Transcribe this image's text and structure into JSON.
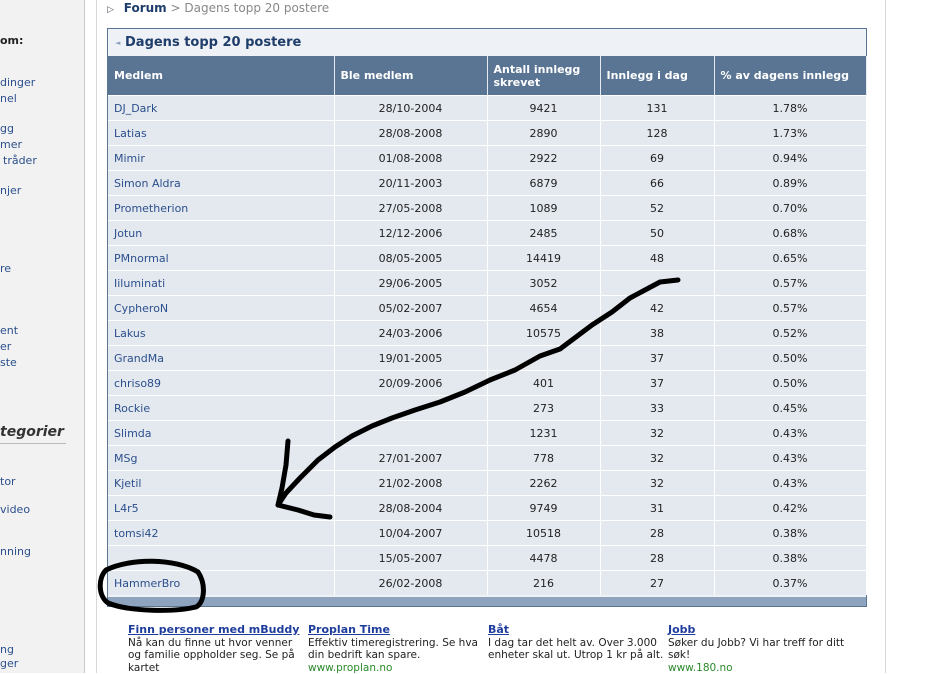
{
  "sidebar": {
    "header": "om:",
    "items": [
      "dinger",
      "nel",
      "gg",
      "mer",
      "tråder",
      "njer",
      "re",
      "ent",
      "er",
      "ste"
    ],
    "category_title": "tegorier",
    "category_items": [
      "tor",
      "video",
      "nning",
      "ng",
      "ger"
    ]
  },
  "breadcrumb": {
    "root": "Forum",
    "separator": ">",
    "current": "Dagens topp 20 postere"
  },
  "panel": {
    "title": "Dagens topp 20 postere",
    "columns": [
      "Medlem",
      "Ble medlem",
      "Antall innlegg skrevet",
      "Innlegg i dag",
      "% av dagens innlegg"
    ],
    "rows": [
      {
        "name": "DJ_Dark",
        "joined": "28/10-2004",
        "posts": "9421",
        "today": "131",
        "pct": "1.78%"
      },
      {
        "name": "Latias",
        "joined": "28/08-2008",
        "posts": "2890",
        "today": "128",
        "pct": "1.73%"
      },
      {
        "name": "Mimir",
        "joined": "01/08-2008",
        "posts": "2922",
        "today": "69",
        "pct": "0.94%"
      },
      {
        "name": "Simon Aldra",
        "joined": "20/11-2003",
        "posts": "6879",
        "today": "66",
        "pct": "0.89%"
      },
      {
        "name": "Prometherion",
        "joined": "27/05-2008",
        "posts": "1089",
        "today": "52",
        "pct": "0.70%"
      },
      {
        "name": "Jotun",
        "joined": "12/12-2006",
        "posts": "2485",
        "today": "50",
        "pct": "0.68%"
      },
      {
        "name": "PMnormal",
        "joined": "08/05-2005",
        "posts": "14419",
        "today": "48",
        "pct": "0.65%"
      },
      {
        "name": "Iiluminati",
        "joined": "29/06-2005",
        "posts": "3052",
        "today": "",
        "pct": "0.57%"
      },
      {
        "name": "CypheroN",
        "joined": "05/02-2007",
        "posts": "4654",
        "today": "42",
        "pct": "0.57%"
      },
      {
        "name": "Lakus",
        "joined": "24/03-2006",
        "posts": "10575",
        "today": "38",
        "pct": "0.52%"
      },
      {
        "name": "GrandMa",
        "joined": "19/01-2005",
        "posts": "",
        "today": "37",
        "pct": "0.50%"
      },
      {
        "name": "chriso89",
        "joined": "20/09-2006",
        "posts": "401",
        "today": "37",
        "pct": "0.50%"
      },
      {
        "name": "Rockie",
        "joined": "",
        "posts": "273",
        "today": "33",
        "pct": "0.45%"
      },
      {
        "name": "Slimda",
        "joined": "",
        "posts": "1231",
        "today": "32",
        "pct": "0.43%"
      },
      {
        "name": "MSg",
        "joined": "27/01-2007",
        "posts": "778",
        "today": "32",
        "pct": "0.43%"
      },
      {
        "name": "Kjetil",
        "joined": "21/02-2008",
        "posts": "2262",
        "today": "32",
        "pct": "0.43%"
      },
      {
        "name": "L4r5",
        "joined": "28/08-2004",
        "posts": "9749",
        "today": "31",
        "pct": "0.42%"
      },
      {
        "name": "tomsi42",
        "joined": "10/04-2007",
        "posts": "10518",
        "today": "28",
        "pct": "0.38%"
      },
      {
        "name": "",
        "joined": "15/05-2007",
        "posts": "4478",
        "today": "28",
        "pct": "0.38%"
      },
      {
        "name": "HammerBro",
        "joined": "26/02-2008",
        "posts": "216",
        "today": "27",
        "pct": "0.37%"
      }
    ]
  },
  "ads": [
    {
      "title": "Finn personer med mBuddy",
      "text": "Nå kan du finne ut hvor venner og familie oppholder seg. Se på kartet",
      "url": ""
    },
    {
      "title": "Proplan Time",
      "text": "Effektiv timeregistrering. Se hva din bedrift kan spare.",
      "url": "www.proplan.no"
    },
    {
      "title": "Båt",
      "text": "I dag tar det helt av. Over 3.000 enheter skal ut. Utrop 1 kr på alt.",
      "url": ""
    },
    {
      "title": "Jobb",
      "text": "Søker du Jobb? Vi har treff for ditt søk!",
      "url": "www.180.no"
    }
  ],
  "colors": {
    "header_bg": "#5a7493",
    "row_bg": "#e4e9f0",
    "link": "#2b4f8c",
    "annotation": "#000000"
  }
}
